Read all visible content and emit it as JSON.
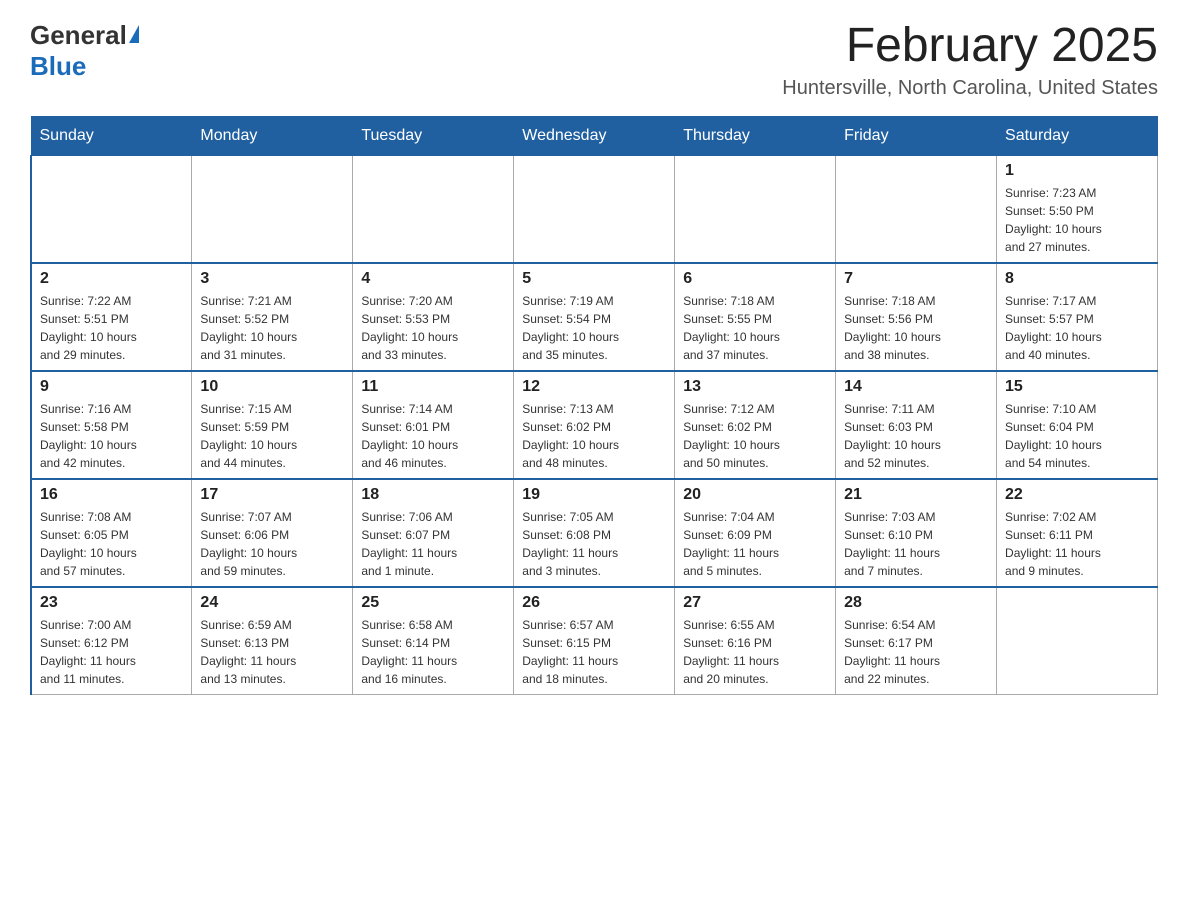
{
  "logo": {
    "general": "General",
    "blue": "Blue"
  },
  "title": "February 2025",
  "location": "Huntersville, North Carolina, United States",
  "weekdays": [
    "Sunday",
    "Monday",
    "Tuesday",
    "Wednesday",
    "Thursday",
    "Friday",
    "Saturday"
  ],
  "weeks": [
    [
      {
        "day": "",
        "info": ""
      },
      {
        "day": "",
        "info": ""
      },
      {
        "day": "",
        "info": ""
      },
      {
        "day": "",
        "info": ""
      },
      {
        "day": "",
        "info": ""
      },
      {
        "day": "",
        "info": ""
      },
      {
        "day": "1",
        "info": "Sunrise: 7:23 AM\nSunset: 5:50 PM\nDaylight: 10 hours\nand 27 minutes."
      }
    ],
    [
      {
        "day": "2",
        "info": "Sunrise: 7:22 AM\nSunset: 5:51 PM\nDaylight: 10 hours\nand 29 minutes."
      },
      {
        "day": "3",
        "info": "Sunrise: 7:21 AM\nSunset: 5:52 PM\nDaylight: 10 hours\nand 31 minutes."
      },
      {
        "day": "4",
        "info": "Sunrise: 7:20 AM\nSunset: 5:53 PM\nDaylight: 10 hours\nand 33 minutes."
      },
      {
        "day": "5",
        "info": "Sunrise: 7:19 AM\nSunset: 5:54 PM\nDaylight: 10 hours\nand 35 minutes."
      },
      {
        "day": "6",
        "info": "Sunrise: 7:18 AM\nSunset: 5:55 PM\nDaylight: 10 hours\nand 37 minutes."
      },
      {
        "day": "7",
        "info": "Sunrise: 7:18 AM\nSunset: 5:56 PM\nDaylight: 10 hours\nand 38 minutes."
      },
      {
        "day": "8",
        "info": "Sunrise: 7:17 AM\nSunset: 5:57 PM\nDaylight: 10 hours\nand 40 minutes."
      }
    ],
    [
      {
        "day": "9",
        "info": "Sunrise: 7:16 AM\nSunset: 5:58 PM\nDaylight: 10 hours\nand 42 minutes."
      },
      {
        "day": "10",
        "info": "Sunrise: 7:15 AM\nSunset: 5:59 PM\nDaylight: 10 hours\nand 44 minutes."
      },
      {
        "day": "11",
        "info": "Sunrise: 7:14 AM\nSunset: 6:01 PM\nDaylight: 10 hours\nand 46 minutes."
      },
      {
        "day": "12",
        "info": "Sunrise: 7:13 AM\nSunset: 6:02 PM\nDaylight: 10 hours\nand 48 minutes."
      },
      {
        "day": "13",
        "info": "Sunrise: 7:12 AM\nSunset: 6:02 PM\nDaylight: 10 hours\nand 50 minutes."
      },
      {
        "day": "14",
        "info": "Sunrise: 7:11 AM\nSunset: 6:03 PM\nDaylight: 10 hours\nand 52 minutes."
      },
      {
        "day": "15",
        "info": "Sunrise: 7:10 AM\nSunset: 6:04 PM\nDaylight: 10 hours\nand 54 minutes."
      }
    ],
    [
      {
        "day": "16",
        "info": "Sunrise: 7:08 AM\nSunset: 6:05 PM\nDaylight: 10 hours\nand 57 minutes."
      },
      {
        "day": "17",
        "info": "Sunrise: 7:07 AM\nSunset: 6:06 PM\nDaylight: 10 hours\nand 59 minutes."
      },
      {
        "day": "18",
        "info": "Sunrise: 7:06 AM\nSunset: 6:07 PM\nDaylight: 11 hours\nand 1 minute."
      },
      {
        "day": "19",
        "info": "Sunrise: 7:05 AM\nSunset: 6:08 PM\nDaylight: 11 hours\nand 3 minutes."
      },
      {
        "day": "20",
        "info": "Sunrise: 7:04 AM\nSunset: 6:09 PM\nDaylight: 11 hours\nand 5 minutes."
      },
      {
        "day": "21",
        "info": "Sunrise: 7:03 AM\nSunset: 6:10 PM\nDaylight: 11 hours\nand 7 minutes."
      },
      {
        "day": "22",
        "info": "Sunrise: 7:02 AM\nSunset: 6:11 PM\nDaylight: 11 hours\nand 9 minutes."
      }
    ],
    [
      {
        "day": "23",
        "info": "Sunrise: 7:00 AM\nSunset: 6:12 PM\nDaylight: 11 hours\nand 11 minutes."
      },
      {
        "day": "24",
        "info": "Sunrise: 6:59 AM\nSunset: 6:13 PM\nDaylight: 11 hours\nand 13 minutes."
      },
      {
        "day": "25",
        "info": "Sunrise: 6:58 AM\nSunset: 6:14 PM\nDaylight: 11 hours\nand 16 minutes."
      },
      {
        "day": "26",
        "info": "Sunrise: 6:57 AM\nSunset: 6:15 PM\nDaylight: 11 hours\nand 18 minutes."
      },
      {
        "day": "27",
        "info": "Sunrise: 6:55 AM\nSunset: 6:16 PM\nDaylight: 11 hours\nand 20 minutes."
      },
      {
        "day": "28",
        "info": "Sunrise: 6:54 AM\nSunset: 6:17 PM\nDaylight: 11 hours\nand 22 minutes."
      },
      {
        "day": "",
        "info": ""
      }
    ]
  ]
}
